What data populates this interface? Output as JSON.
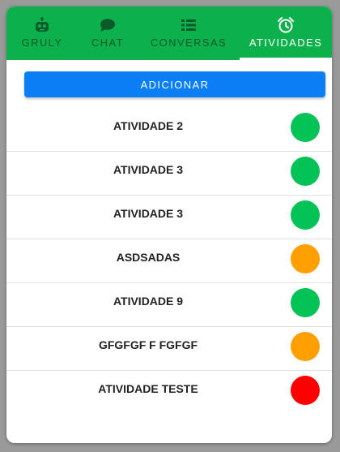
{
  "tabs": [
    {
      "label": "GRULY",
      "icon": "robot-icon"
    },
    {
      "label": "CHAT",
      "icon": "chat-bubble-icon"
    },
    {
      "label": "CONVERSAS",
      "icon": "list-icon"
    },
    {
      "label": "ATIVIDADES",
      "icon": "alarm-clock-icon",
      "active": true
    }
  ],
  "add_button_label": "ADICIONAR",
  "colors": {
    "header_bg": "#0db14b",
    "button_bg": "#0a7ff5",
    "status_green": "#04c356",
    "status_orange": "#ff9f00",
    "status_red": "#ff0000"
  },
  "activities": [
    {
      "title": "ATIVIDADE 2",
      "status": "green"
    },
    {
      "title": "ATIVIDADE 3",
      "status": "green"
    },
    {
      "title": "ATIVIDADE 3",
      "status": "green"
    },
    {
      "title": "ASDSADAS",
      "status": "orange"
    },
    {
      "title": "ATIVIDADE 9",
      "status": "green"
    },
    {
      "title": "GFGFGF F FGFGF",
      "status": "orange"
    },
    {
      "title": "ATIVIDADE TESTE",
      "status": "red"
    }
  ]
}
